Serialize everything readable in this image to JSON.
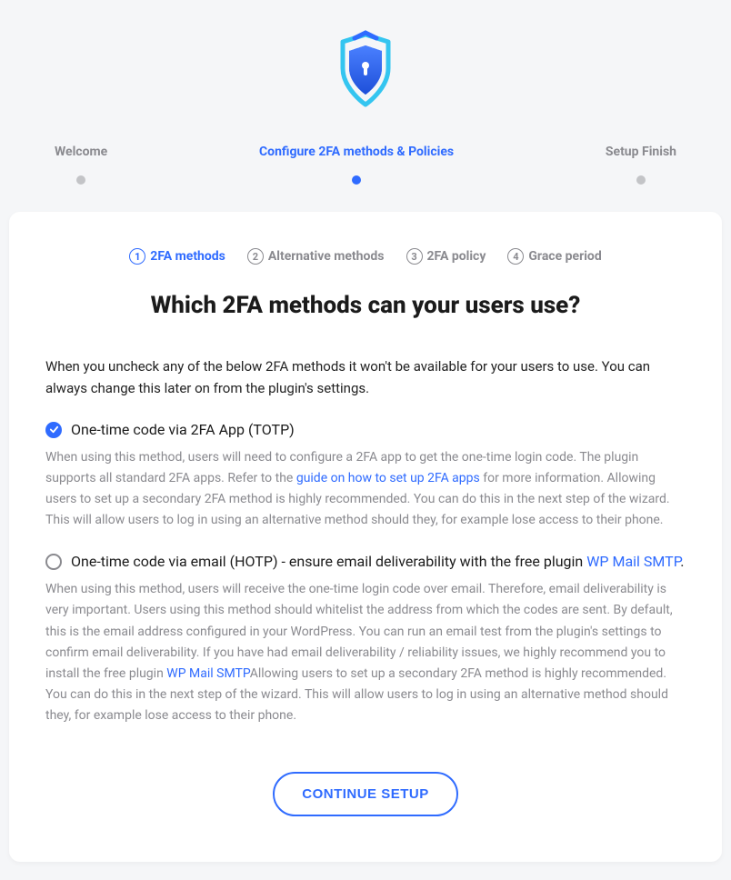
{
  "main_steps": [
    {
      "label": "Welcome",
      "active": false
    },
    {
      "label": "Configure 2FA methods & Policies",
      "active": true
    },
    {
      "label": "Setup Finish",
      "active": false
    }
  ],
  "sub_steps": [
    {
      "num": "1",
      "label": "2FA methods",
      "active": true
    },
    {
      "num": "2",
      "label": "Alternative methods",
      "active": false
    },
    {
      "num": "3",
      "label": "2FA policy",
      "active": false
    },
    {
      "num": "4",
      "label": "Grace period",
      "active": false
    }
  ],
  "title": "Which 2FA methods can your users use?",
  "intro": "When you uncheck any of the below 2FA methods it won't be available for your users to use. You can always change this later on from the plugin's settings.",
  "method1": {
    "title": "One-time code via 2FA App (TOTP)",
    "desc_a": "When using this method, users will need to configure a 2FA app to get the one-time login code. The plugin supports all standard 2FA apps. Refer to the ",
    "link": "guide on how to set up 2FA apps",
    "desc_b": " for more information. Allowing users to set up a secondary 2FA method is highly recommended. You can do this in the next step of the wizard. This will allow users to log in using an alternative method should they, for example lose access to their phone."
  },
  "method2": {
    "title_a": "One-time code via email (HOTP) - ensure email deliverability with the free plugin ",
    "title_link": "WP Mail SMTP",
    "title_b": ".",
    "desc_a": "When using this method, users will receive the one-time login code over email. Therefore, email deliverability is very important. Users using this method should whitelist the address from which the codes are sent. By default, this is the email address configured in your WordPress. You can run an email test from the plugin's settings to confirm email deliverability. If you have had email deliverability / reliability issues, we highly recommend you to install the free plugin ",
    "link": "WP Mail SMTP",
    "desc_b": "Allowing users to set up a secondary 2FA method is highly recommended. You can do this in the next step of the wizard. This will allow users to log in using an alternative method should they, for example lose access to their phone."
  },
  "continue_label": "CONTINUE SETUP"
}
